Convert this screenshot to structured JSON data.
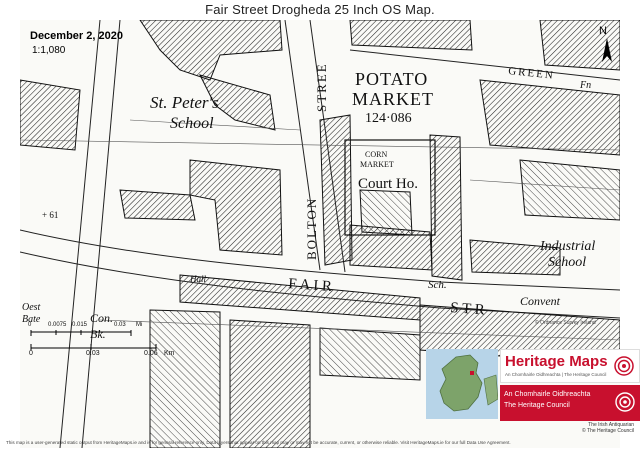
{
  "header": {
    "title": "Fair Street Drogheda 25 Inch OS Map."
  },
  "map": {
    "date": "December 2, 2020",
    "scale": "1:1,080",
    "compass_letter": "N",
    "labels": {
      "potato": "POTATO",
      "market": "MARKET",
      "area": "124·086",
      "st_peters": "St. Peter's",
      "school": "School",
      "corn": "CORN",
      "corn_market": "MARKET",
      "court": "Court Ho.",
      "bolton": "BOLTON",
      "stree": "STREE",
      "green": "GREEN",
      "fn": "Fn",
      "industrial": "Industrial",
      "school2": "School",
      "fair": "F  A  I  R",
      "street": "S  T  R",
      "sch": "Sch.",
      "convent": "Convent",
      "hall": "Hall",
      "con": "Con.",
      "bk": "Bk.",
      "post": "Oest",
      "bate": "Bate",
      "spot": "+ 61"
    },
    "scalebar": {
      "top_ticks": [
        "0",
        "0.0075",
        "0.015",
        "0.03",
        "Mi"
      ],
      "bottom_ticks": [
        "0",
        "0.03",
        "0.06",
        "Km"
      ]
    },
    "osi_credit": "© Ordnance Survey Ireland"
  },
  "logo": {
    "title": "Heritage Maps",
    "subtitle": "An Chomhairle Oidhreachta | The Heritage Council",
    "council_ga": "An Chomhairle Oidhreachta",
    "council_en": "The Heritage Council"
  },
  "credits": {
    "line1": "The Irish Antiquarian",
    "line2": "© The Heritage Council"
  },
  "footer": {
    "disclaimer": "This map is a user-generated static output from HeritageMaps.ie and is for general reference only. Data layers that appear on this map may or may not be accurate, current, or otherwise reliable. Visit HeritageMaps.ie for our full Data Use Agreement."
  },
  "colors": {
    "brand_red": "#c8102e",
    "ink": "#111111",
    "sea": "#b7d4e8",
    "land": "#7da36a"
  }
}
